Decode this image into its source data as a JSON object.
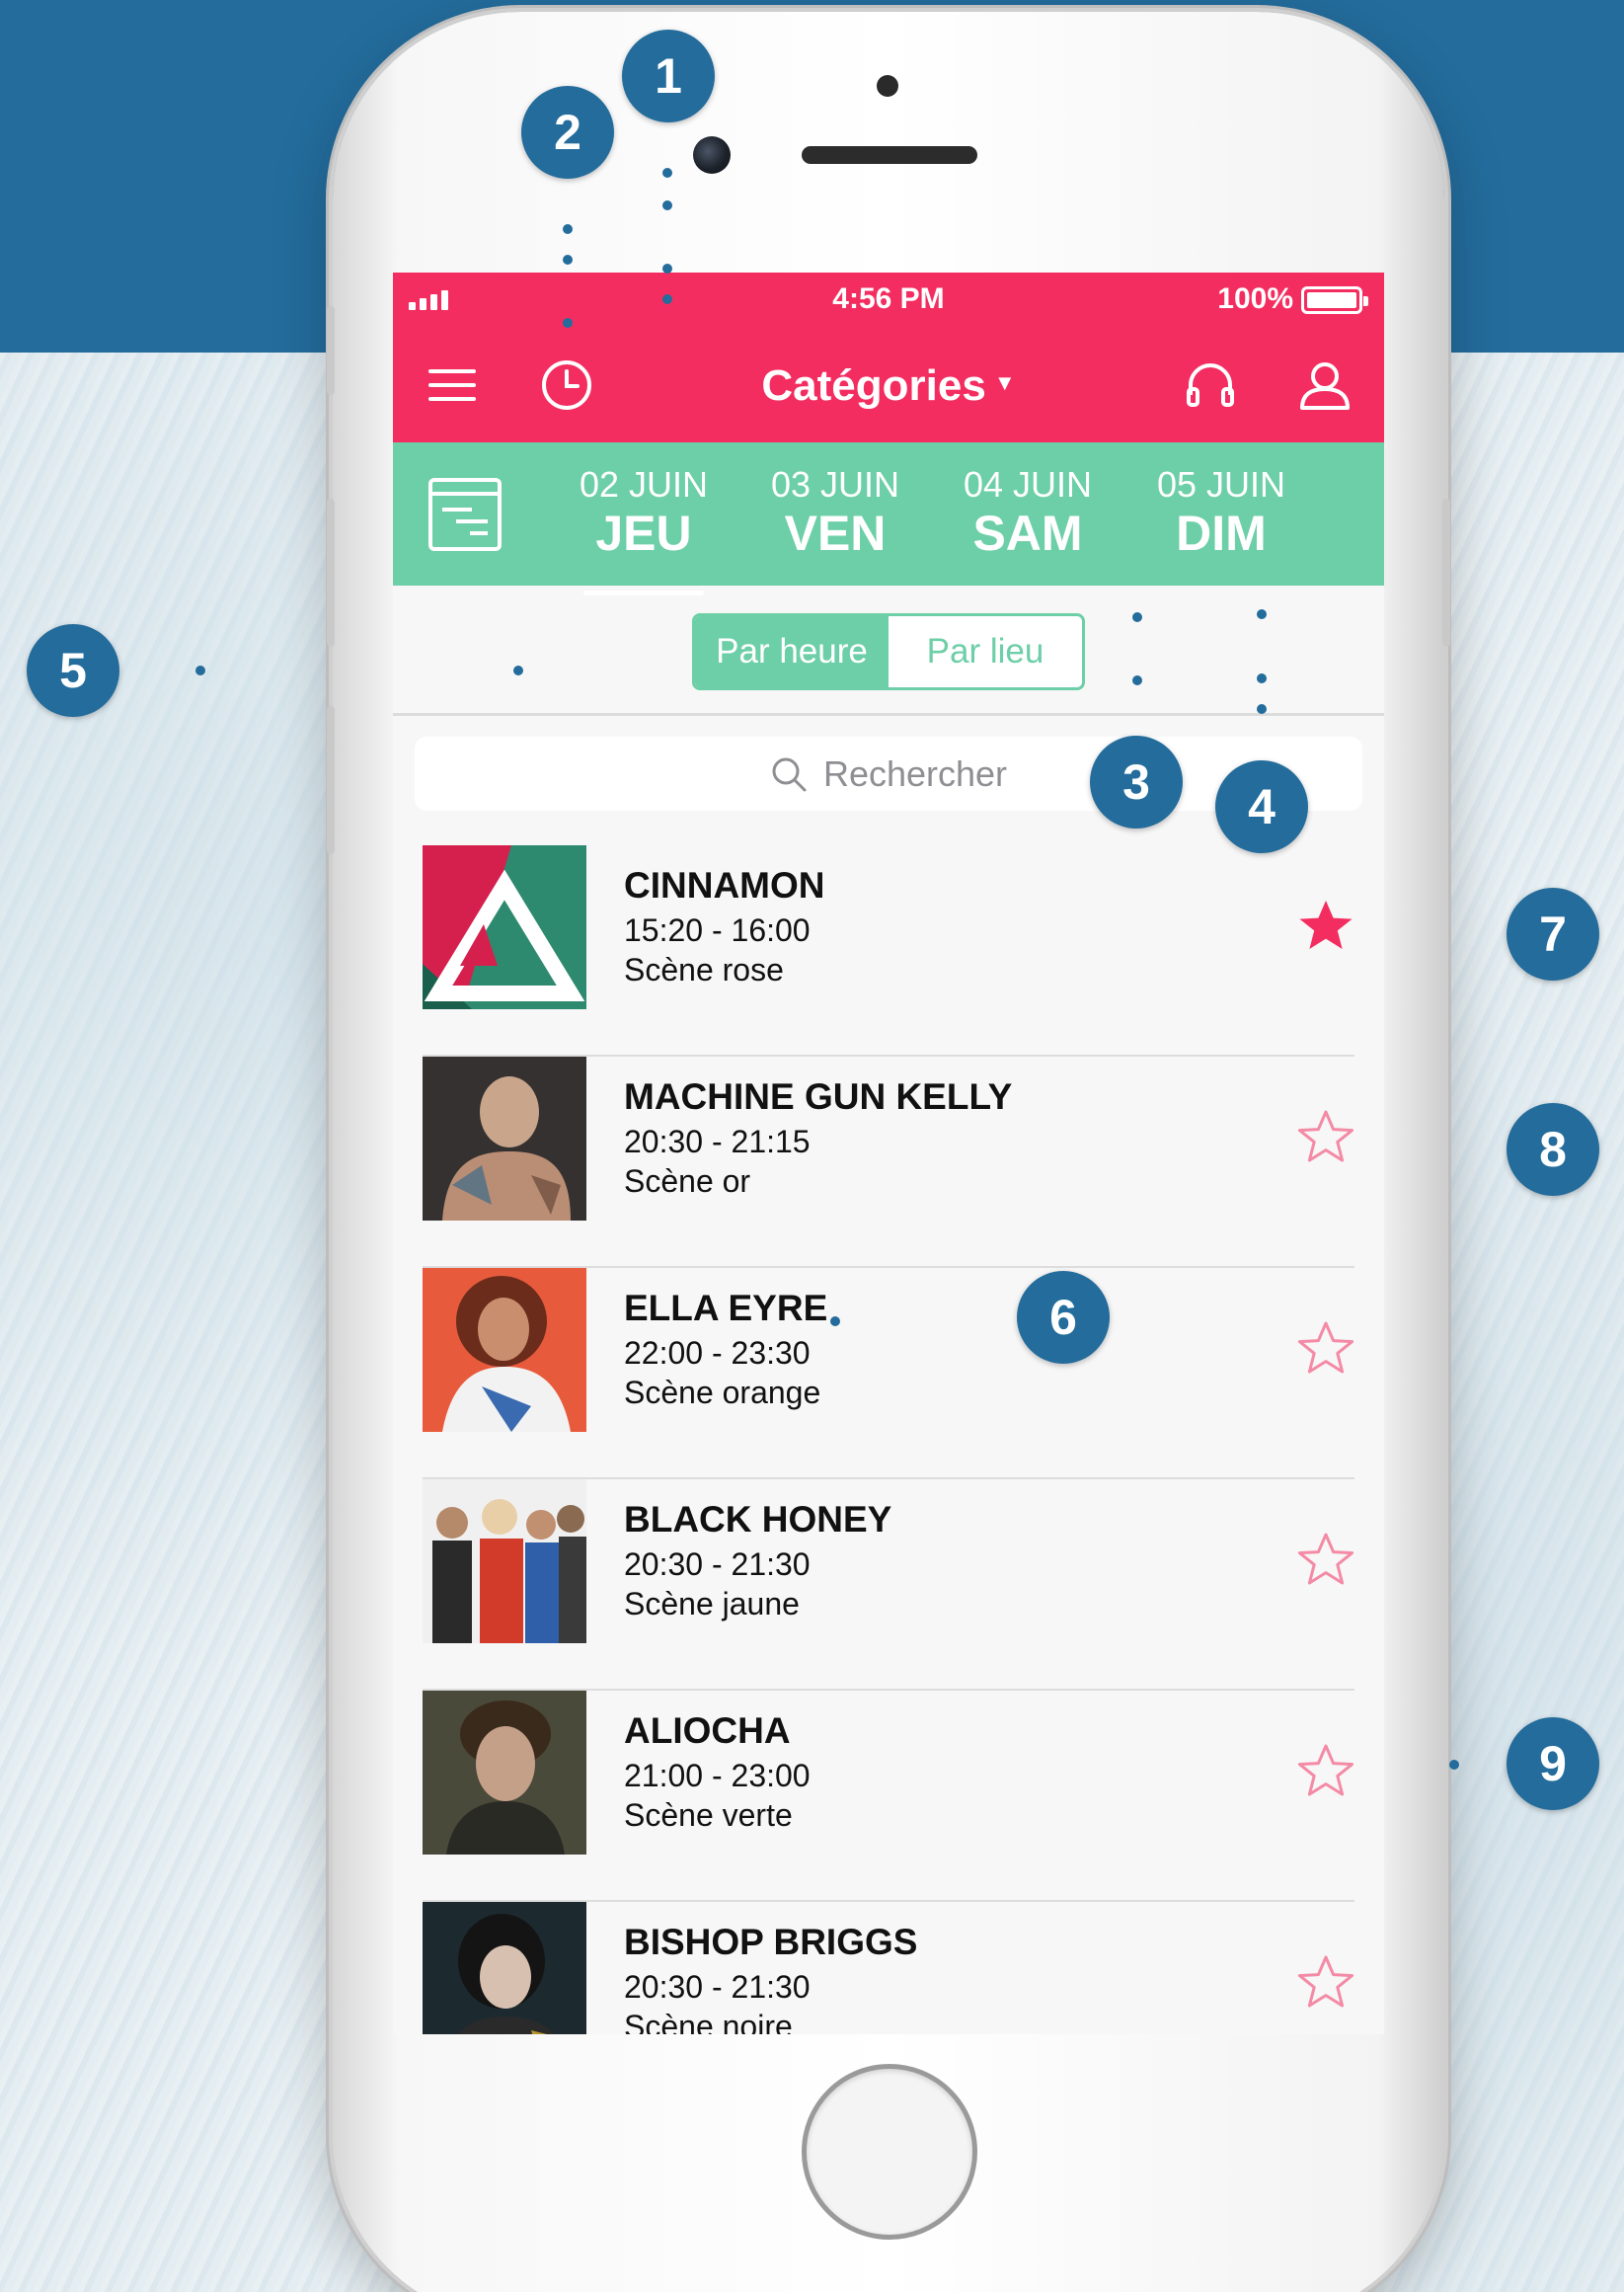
{
  "status_bar": {
    "time": "4:56 PM",
    "battery": "100%"
  },
  "header": {
    "title": "Catégories"
  },
  "icons": {
    "menu": "hamburger-menu-icon",
    "history": "clock-icon",
    "audio": "headphones-icon",
    "profile": "user-icon",
    "program": "program-icon",
    "search": "search-icon",
    "favorite": "star-icon"
  },
  "days": [
    {
      "date": "02 JUIN",
      "weekday": "JEU",
      "active": true
    },
    {
      "date": "03 JUIN",
      "weekday": "VEN",
      "active": false
    },
    {
      "date": "04 JUIN",
      "weekday": "SAM",
      "active": false
    },
    {
      "date": "05 JUIN",
      "weekday": "DIM",
      "active": false
    }
  ],
  "view_toggle": {
    "by_time": "Par heure",
    "by_place": "Par lieu",
    "selected": "Par heure"
  },
  "search": {
    "placeholder": "Rechercher"
  },
  "artists": [
    {
      "name": "CINNAMON",
      "time": "15:20 - 16:00",
      "stage": "Scène rose",
      "favorite": true
    },
    {
      "name": "MACHINE GUN KELLY",
      "time": "20:30 - 21:15",
      "stage": "Scène or",
      "favorite": false
    },
    {
      "name": "ELLA EYRE",
      "time": "22:00 - 23:30",
      "stage": "Scène orange",
      "favorite": false
    },
    {
      "name": "BLACK HONEY",
      "time": "20:30 - 21:30",
      "stage": "Scène jaune",
      "favorite": false
    },
    {
      "name": "ALIOCHA",
      "time": "21:00 - 23:00",
      "stage": "Scène verte",
      "favorite": false
    },
    {
      "name": "BISHOP BRIGGS",
      "time": "20:30 - 21:30",
      "stage": "Scène noire",
      "favorite": false
    }
  ],
  "annotations": [
    "1",
    "2",
    "3",
    "4",
    "5",
    "6",
    "7",
    "8",
    "9"
  ],
  "colors": {
    "primary": "#f42d60",
    "secondary": "#6dcfa7",
    "annotation": "#236c9c"
  }
}
